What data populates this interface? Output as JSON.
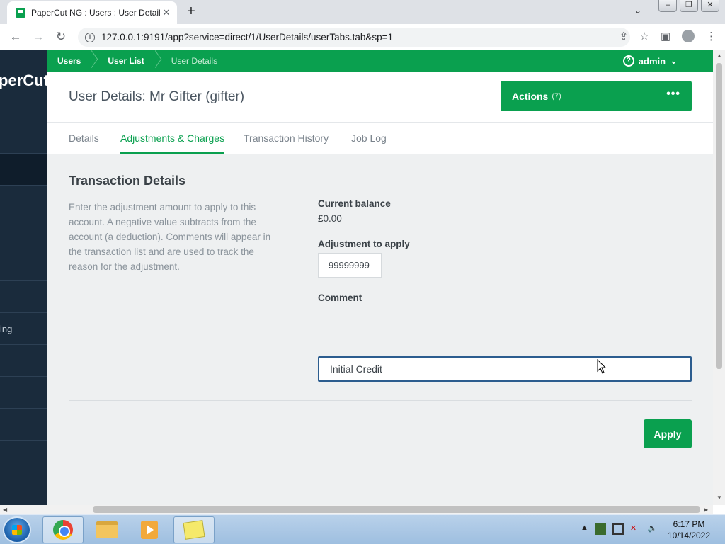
{
  "browser": {
    "tab_title": "PaperCut NG : Users : User Detail",
    "tab_close": "✕",
    "new_tab": "+",
    "url": "127.0.0.1:9191/app?service=direct/1/UserDetails/userTabs.tab&sp=1"
  },
  "sidebar": {
    "logo": "perCut",
    "items": [
      "",
      "",
      "",
      "",
      "",
      "ing",
      "",
      "",
      "",
      ""
    ]
  },
  "breadcrumb": {
    "items": [
      "Users",
      "User List",
      "User Details"
    ]
  },
  "user_menu": {
    "name": "admin"
  },
  "header": {
    "title": "User Details: Mr Gifter (gifter)",
    "actions_label": "Actions",
    "actions_count": "(7)"
  },
  "tabs": [
    "Details",
    "Adjustments & Charges",
    "Transaction History",
    "Job Log"
  ],
  "form": {
    "section_title": "Transaction Details",
    "description": "Enter the adjustment amount to apply to this account. A negative value subtracts from the account (a deduction). Comments will appear in the transaction list and are used to track the reason for the adjustment.",
    "balance_label": "Current balance",
    "balance_value": "£0.00",
    "adjustment_label": "Adjustment to apply",
    "adjustment_value": "99999999",
    "comment_label": "Comment",
    "comment_value": "Initial Credit",
    "apply_label": "Apply"
  },
  "taskbar": {
    "time": "6:17 PM",
    "date": "10/14/2022"
  },
  "colors": {
    "brand_green": "#0aa04f",
    "sidebar_navy": "#1a2b3c",
    "focus_blue": "#2c5d8f"
  }
}
